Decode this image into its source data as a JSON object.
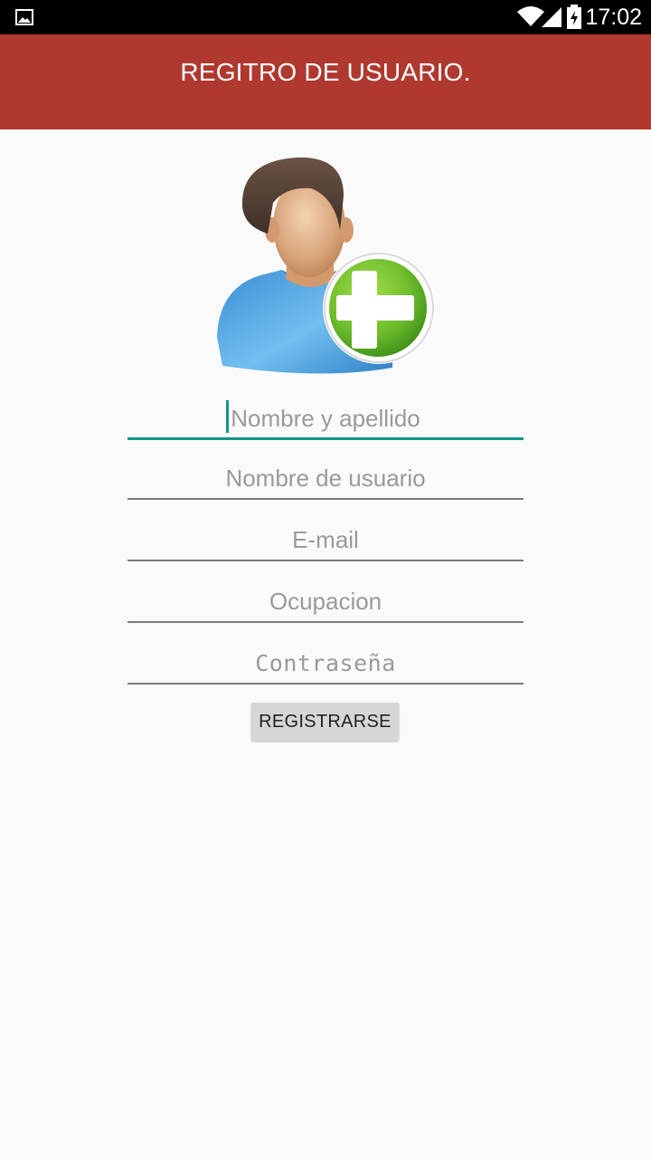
{
  "status_bar": {
    "time": "17:02",
    "icons": [
      "image-notification-icon",
      "wifi-icon",
      "signal-icon",
      "battery-charging-icon"
    ]
  },
  "app_bar": {
    "title": "REGITRO DE USUARIO.",
    "color": "#b0392f"
  },
  "avatar": {
    "icon": "add-user-avatar-icon",
    "accent": "#6fbe2c"
  },
  "form": {
    "fields": [
      {
        "placeholder": "Nombre y apellido",
        "value": "",
        "focused": true
      },
      {
        "placeholder": "Nombre de usuario",
        "value": ""
      },
      {
        "placeholder": "E-mail",
        "value": ""
      },
      {
        "placeholder": "Ocupacion",
        "value": ""
      },
      {
        "placeholder": "Contraseña",
        "value": ""
      }
    ],
    "focus_color": "#12968a",
    "submit_label": "REGISTRARSE"
  }
}
